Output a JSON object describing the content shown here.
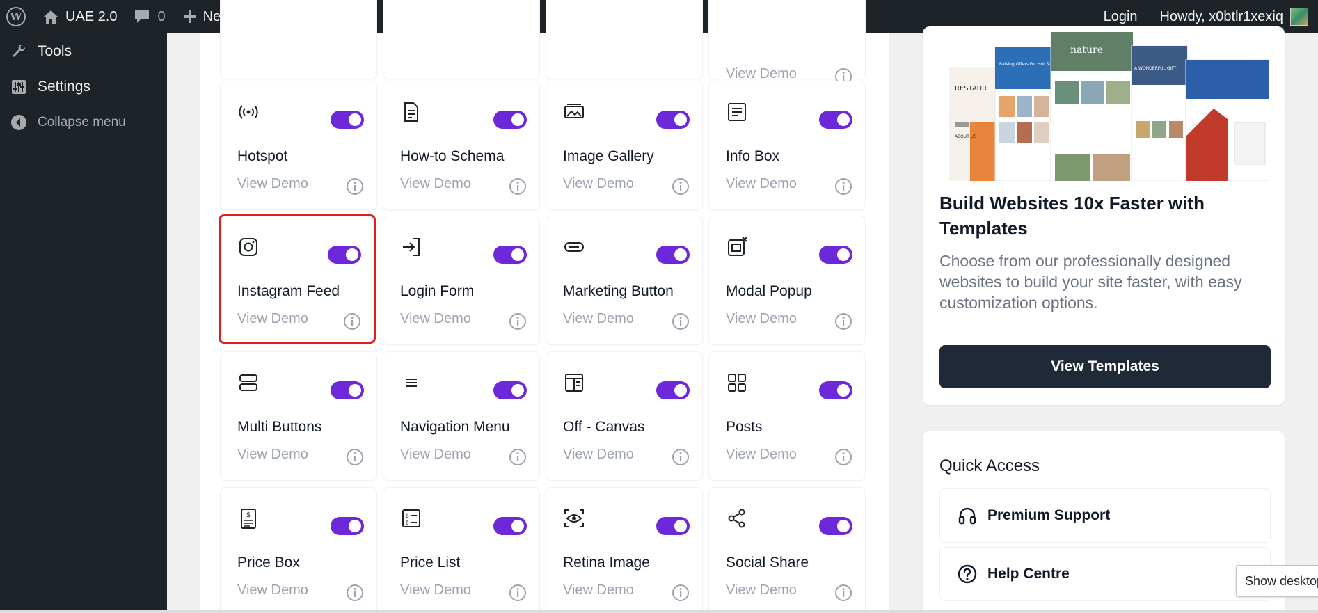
{
  "adminbar": {
    "site_name": "UAE 2.0",
    "comments_count": "0",
    "new_label": "New",
    "login_label": "Login",
    "howdy_label": "Howdy, x0btlr1xexiq"
  },
  "sidebar": {
    "items": [
      {
        "label": "Tools",
        "icon": "wrench-icon"
      },
      {
        "label": "Settings",
        "icon": "sliders-icon"
      },
      {
        "label": "Collapse menu",
        "icon": "collapse-icon"
      }
    ]
  },
  "widgets": {
    "view_demo_label": "View Demo",
    "items": [
      {
        "title": "Hotspot",
        "icon": "hotspot-icon",
        "enabled": true
      },
      {
        "title": "How-to Schema",
        "icon": "document-icon",
        "enabled": true
      },
      {
        "title": "Image Gallery",
        "icon": "gallery-icon",
        "enabled": true
      },
      {
        "title": "Info Box",
        "icon": "info-box-icon",
        "enabled": true
      },
      {
        "title": "Instagram Feed",
        "icon": "instagram-icon",
        "enabled": true
      },
      {
        "title": "Login Form",
        "icon": "login-icon",
        "enabled": true
      },
      {
        "title": "Marketing Button",
        "icon": "button-icon",
        "enabled": true
      },
      {
        "title": "Modal Popup",
        "icon": "modal-icon",
        "enabled": true
      },
      {
        "title": "Multi Buttons",
        "icon": "multi-buttons-icon",
        "enabled": true
      },
      {
        "title": "Navigation Menu",
        "icon": "menu-lines-icon",
        "enabled": true
      },
      {
        "title": "Off - Canvas",
        "icon": "off-canvas-icon",
        "enabled": true
      },
      {
        "title": "Posts",
        "icon": "grid-icon",
        "enabled": true
      },
      {
        "title": "Price Box",
        "icon": "price-box-icon",
        "enabled": true
      },
      {
        "title": "Price List",
        "icon": "price-list-icon",
        "enabled": true
      },
      {
        "title": "Retina Image",
        "icon": "eye-scan-icon",
        "enabled": true
      },
      {
        "title": "Social Share",
        "icon": "share-icon",
        "enabled": true
      }
    ]
  },
  "promo": {
    "title": "Build Websites 10x Faster with Templates",
    "description": "Choose from our professionally designed websites to build your site faster, with easy customization options.",
    "button_label": "View Templates",
    "thumb_texts": {
      "restaurant": "RESTAUR",
      "about": "ABOUT US",
      "offers": "Raising Offers For Hot Summer",
      "nature": "nature",
      "gift": "A WONDERFUL GIFT"
    }
  },
  "quick_access": {
    "title": "Quick Access",
    "items": [
      {
        "label": "Premium Support",
        "icon": "headphones-icon"
      },
      {
        "label": "Help Centre",
        "icon": "question-circle-icon"
      }
    ]
  },
  "tooltip": "Show desktop",
  "colors": {
    "accent": "#6d28d9",
    "adminbar": "#1d2327",
    "selected_border": "#e01e1e",
    "button_dark": "#1f2937"
  }
}
